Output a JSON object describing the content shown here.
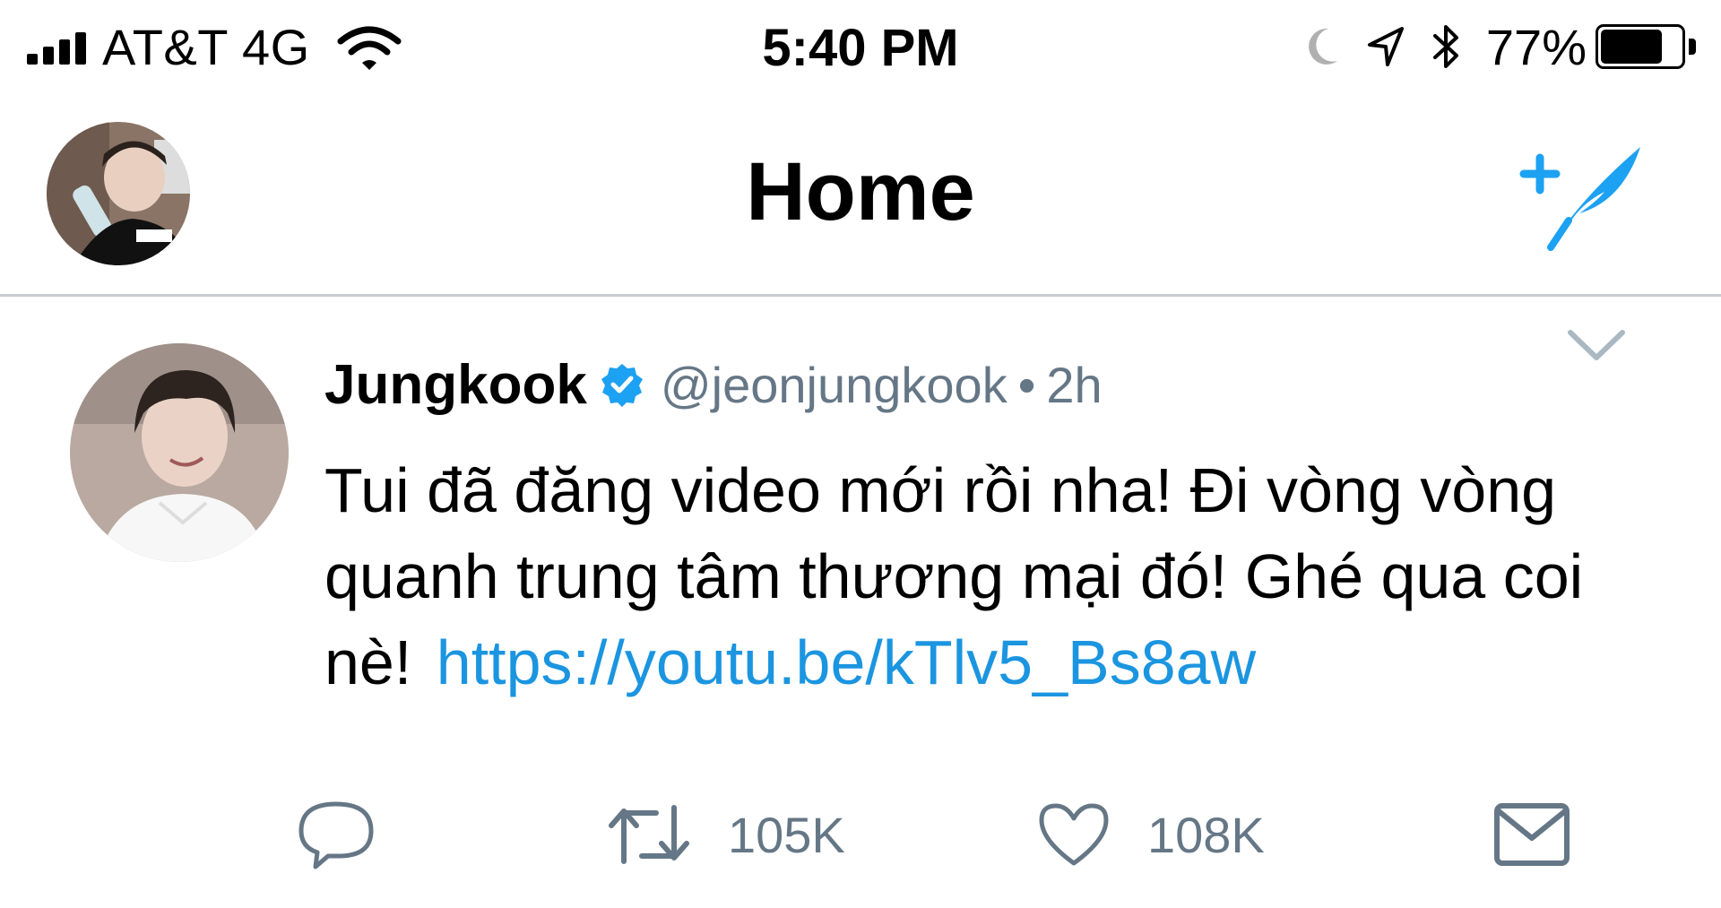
{
  "status_bar": {
    "carrier": "AT&T 4G",
    "time": "5:40 PM",
    "battery_percent": "77%",
    "battery_level": 0.77,
    "icons": [
      "signal-bars-icon",
      "wifi-icon",
      "moon-icon",
      "location-arrow-icon",
      "bluetooth-icon",
      "battery-icon"
    ]
  },
  "header": {
    "title": "Home",
    "compose_icon": "compose-tweet-icon",
    "accent_color": "#1da1f2"
  },
  "tweet": {
    "name": "Jungkook",
    "verified": true,
    "handle": "@jeonjungkook",
    "separator": "•",
    "time": "2h",
    "text": "Tui đã đăng video mới rồi nha! Đi vòng vòng quanh trung tâm thương mại đó! Ghé qua coi nè!",
    "link": "https://youtu.be/kTlv5_Bs8aw",
    "link_color": "#1b95e0",
    "actions": {
      "reply_icon": "reply-bubble-icon",
      "retweet_icon": "retweet-icon",
      "retweet_count": "105K",
      "like_icon": "heart-icon",
      "like_count": "108K",
      "dm_icon": "envelope-icon"
    }
  }
}
